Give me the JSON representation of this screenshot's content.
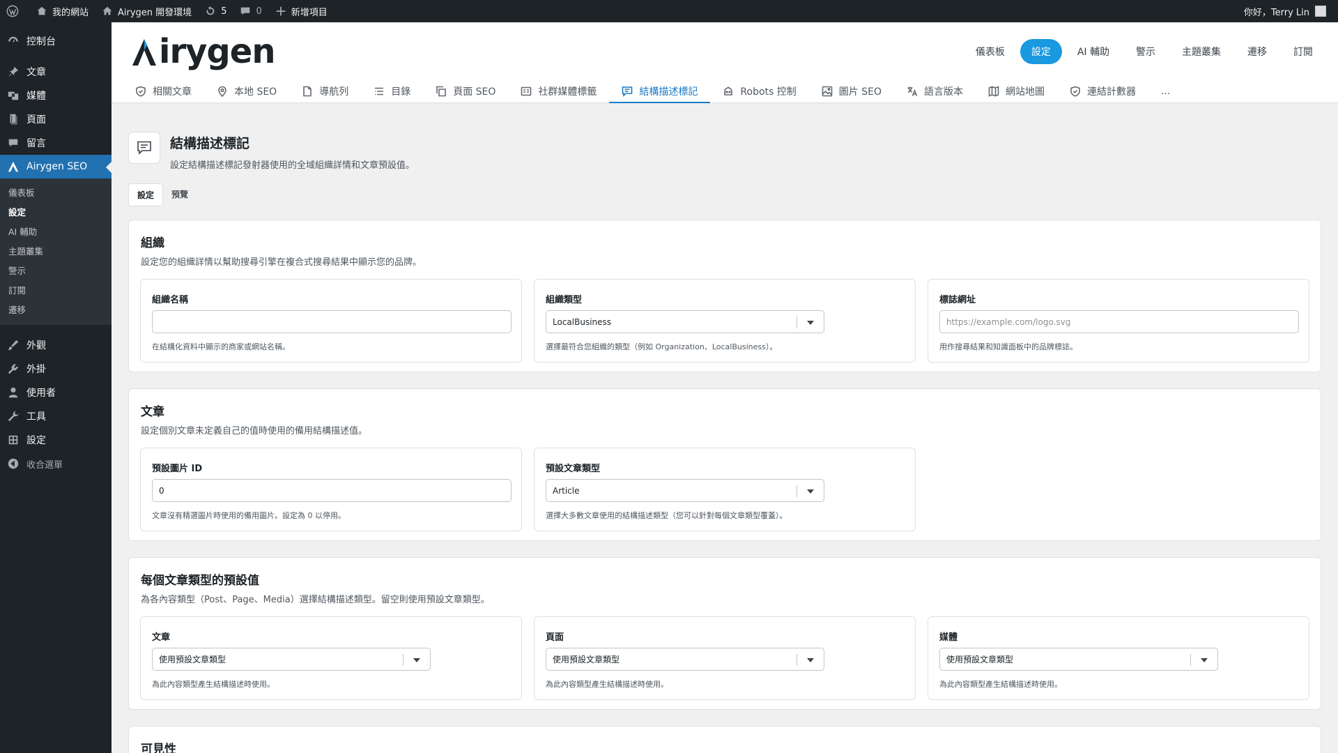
{
  "adminbar": {
    "site_name": "我的網站",
    "env_name": "Airygen 開發環境",
    "updates_count": "5",
    "comments_count": "0",
    "new_item": "新增項目",
    "greeting": "你好，Terry Lin"
  },
  "sidebar": {
    "dashboard": "控制台",
    "posts": "文章",
    "media": "媒體",
    "pages": "頁面",
    "comments": "留言",
    "plugin": "Airygen SEO",
    "sub": [
      "儀表板",
      "設定",
      "AI 輔助",
      "主題叢集",
      "警示",
      "訂閱",
      "遷移"
    ],
    "appearance": "外觀",
    "plugins": "外掛",
    "users": "使用者",
    "tools": "工具",
    "settings": "設定",
    "collapse": "收合選單"
  },
  "header": {
    "logo": "Airygen",
    "top_nav": [
      "儀表板",
      "設定",
      "AI 輔助",
      "警示",
      "主題叢集",
      "遷移",
      "訂閱"
    ],
    "tabs": [
      "相關文章",
      "本地 SEO",
      "導航列",
      "目錄",
      "頁面 SEO",
      "社群媒體標籤",
      "結構描述標記",
      "Robots 控制",
      "圖片 SEO",
      "語言版本",
      "網站地圖",
      "連結計數器",
      "..."
    ]
  },
  "page": {
    "title": "結構描述標記",
    "description": "設定結構描述標記發射器使用的全域組織詳情和文章預設值。",
    "subtabs": [
      "設定",
      "預覽"
    ]
  },
  "org": {
    "title": "組織",
    "description": "設定您的組織詳情以幫助搜尋引擎在複合式搜尋結果中顯示您的品牌。",
    "name_label": "組織名稱",
    "name_value": "",
    "name_help": "在結構化資料中顯示的商家或網站名稱。",
    "type_label": "組織類型",
    "type_value": "LocalBusiness",
    "type_help": "選擇最符合您組織的類型（例如 Organization、LocalBusiness）。",
    "logo_label": "標誌網址",
    "logo_placeholder": "https://example.com/logo.svg",
    "logo_help": "用作搜尋結果和知識面板中的品牌標誌。"
  },
  "article": {
    "title": "文章",
    "description": "設定個別文章未定義自己的值時使用的備用結構描述值。",
    "image_label": "預設圖片 ID",
    "image_value": "0",
    "image_help": "文章沒有精選圖片時使用的備用圖片。設定為 0 以停用。",
    "type_label": "預設文章類型",
    "type_value": "Article",
    "type_help": "選擇大多數文章使用的結構描述類型（您可以針對每個文章類型覆蓋）。"
  },
  "per_type": {
    "title": "每個文章類型的預設值",
    "description": "為各內容類型（Post、Page、Media）選擇結構描述類型。留空則使用預設文章類型。",
    "post_label": "文章",
    "page_label": "頁面",
    "media_label": "媒體",
    "select_value": "使用預設文章類型",
    "help": "為此內容類型產生結構描述時使用。"
  },
  "visibility": {
    "title": "可見性"
  }
}
